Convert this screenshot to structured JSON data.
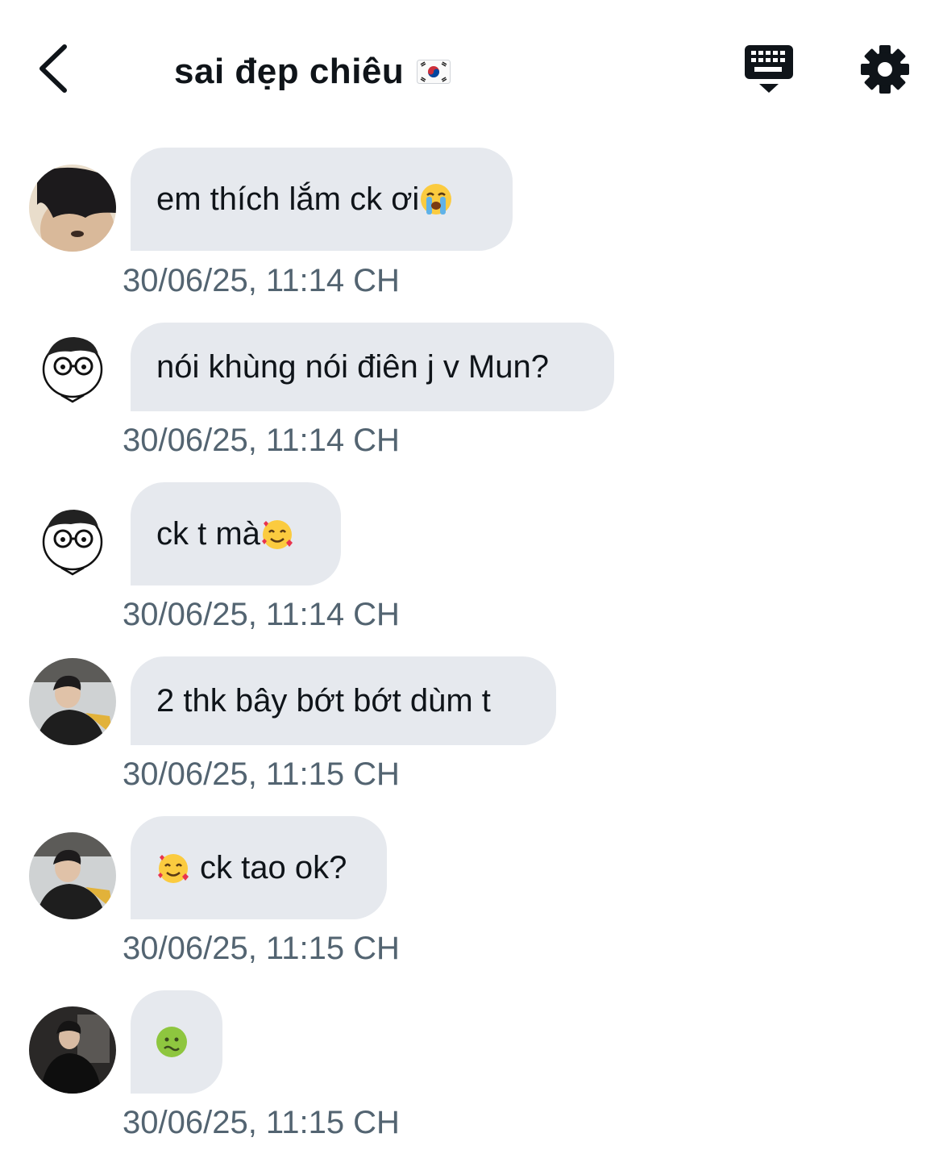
{
  "header": {
    "title": "sai đẹp chiêu",
    "flag_icon": "south-korea-flag-icon",
    "back_icon": "chevron-left-icon",
    "keyboard_icon": "keyboard-icon",
    "settings_icon": "gear-icon"
  },
  "colors": {
    "bubble_bg": "#e6e9ee",
    "timestamp": "#536471",
    "text": "#0f1419"
  },
  "messages": [
    {
      "text": "em thích lắm ck ơi",
      "emoji_after": "loudly-crying-face",
      "timestamp": "30/06/25, 11:14 CH",
      "avatar": "photo-dark-hair"
    },
    {
      "text": "nói khùng nói điên j v Mun?",
      "timestamp": "30/06/25, 11:14 CH",
      "avatar": "cartoon-glasses"
    },
    {
      "text": "ck t mà",
      "emoji_after": "smiling-face-with-hearts",
      "timestamp": "30/06/25, 11:14 CH",
      "avatar": "cartoon-glasses"
    },
    {
      "text": "2 thk bây bớt bớt dùm t",
      "timestamp": "30/06/25, 11:15 CH",
      "avatar": "photo-player-desk"
    },
    {
      "text": "ck tao ok?",
      "emoji_before": "smiling-face-with-hearts",
      "timestamp": "30/06/25, 11:15 CH",
      "avatar": "photo-player-desk"
    },
    {
      "text": "",
      "emoji_only": "nauseated-face",
      "timestamp": "30/06/25, 11:15 CH",
      "avatar": "photo-black-jacket"
    }
  ]
}
